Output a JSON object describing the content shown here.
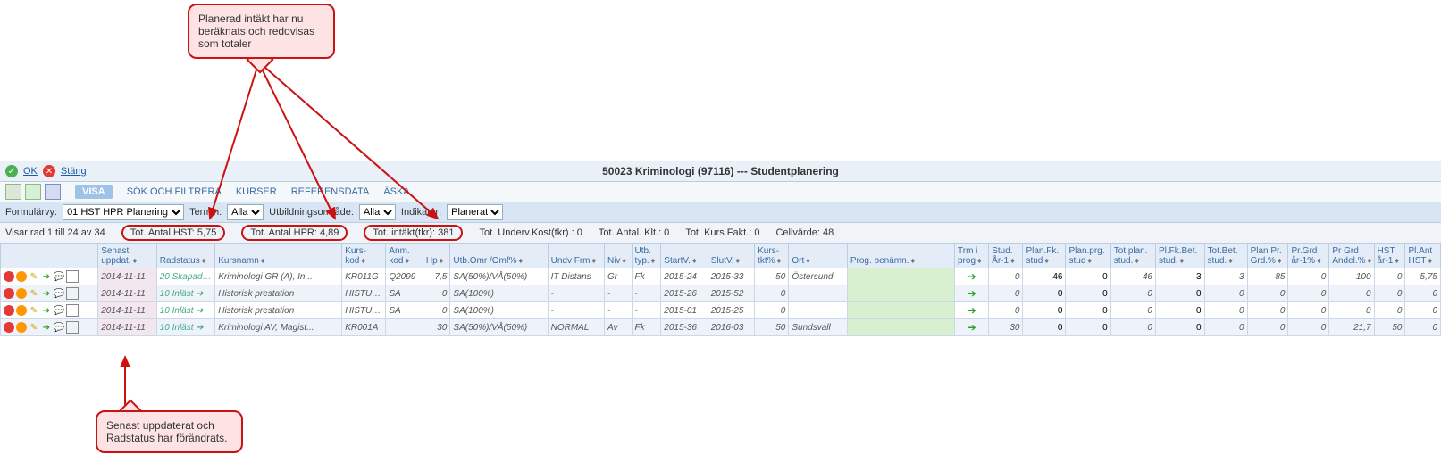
{
  "annotations": {
    "top": "Planerad intäkt har nu beräknats och redovisas som totaler",
    "bottom": "Senast uppdaterat och Radstatus har förändrats."
  },
  "topbar": {
    "ok": "OK",
    "close": "Stäng"
  },
  "page_title": "50023 Kriminologi (97116) --- Studentplanering",
  "toolbar": {
    "tabs": [
      "VISA",
      "SÖK OCH FILTRERA",
      "KURSER",
      "REFERENSDATA",
      "ÄSKA"
    ]
  },
  "filterbar": {
    "formularvy_lbl": "Formulärvy:",
    "formularvy_val": "01 HST HPR Planering",
    "termin_lbl": "Termin:",
    "termin_val": "Alla",
    "utbomr_lbl": "Utbildningsområde:",
    "utbomr_val": "Alla",
    "indikator_lbl": "Indikator:",
    "indikator_val": "Planerat"
  },
  "status": {
    "showing": "Visar rad 1 till 24 av 34",
    "tot_hst": "Tot. Antal HST: 5,75",
    "tot_hpr": "Tot. Antal HPR: 4,89",
    "tot_intakt": "Tot. intäkt(tkr): 381",
    "tot_underv": "Tot. Underv.Kost(tkr).: 0",
    "tot_klt": "Tot. Antal. Klt.: 0",
    "tot_kursfakt": "Tot. Kurs Fakt.: 0",
    "cellvarde": "Cellvärde: 48"
  },
  "headers": [
    "",
    "Senast uppdat.",
    "Radstatus",
    "Kursnamn",
    "Kurs-kod",
    "Anm. kod",
    "Hp",
    "Utb.Omr /Omf%",
    "Undv Frm",
    "Niv",
    "Utb. typ.",
    "StartV.",
    "SlutV.",
    "Kurs-tkt%",
    "Ort",
    "Prog. benämn.",
    "Trm i prog",
    "Stud. År-1",
    "Plan.Fk. stud",
    "Plan.prg. stud",
    "Tot.plan. stud.",
    "Pl.Fk.Bet. stud.",
    "Tot.Bet. stud.",
    "Plan Pr. Grd.%",
    "Pr.Grd år-1%",
    "Pr Grd Andel.%",
    "HST år-1",
    "Pl.Ant HST"
  ],
  "rows": [
    {
      "date": "2014-11-11",
      "status": "20 Skapad",
      "kursnamn": "Kriminologi GR (A), In...",
      "kurskod": "KR011G",
      "anmkod": "Q2099",
      "hp": "7,5",
      "utbomr": "SA(50%)/VÅ(50%)",
      "undvfrm": "IT Distans",
      "niv": "Gr",
      "utbtyp": "Fk",
      "startv": "2015-24",
      "slutv": "2015-33",
      "tkt": "50",
      "ort": "Östersund",
      "prog": "",
      "trm": "→",
      "studar1": "0",
      "planfk": "46",
      "planprg": "0",
      "totplan": "46",
      "plfkbet": "3",
      "totbet": "3",
      "planpr": "85",
      "prgrdar1": "0",
      "prgrdandel": "100",
      "hstar1": "0",
      "plant": "5,75",
      "alt": false
    },
    {
      "date": "2014-11-11",
      "status": "10 Inläst",
      "kursnamn": "Historisk prestation",
      "kurskod": "HISTUTF",
      "anmkod": "SA",
      "hp": "0",
      "utbomr": "SA(100%)",
      "undvfrm": "-",
      "niv": "-",
      "utbtyp": "-",
      "startv": "2015-26",
      "slutv": "2015-52",
      "tkt": "0",
      "ort": "",
      "prog": "",
      "trm": "→",
      "studar1": "0",
      "planfk": "0",
      "planprg": "0",
      "totplan": "0",
      "plfkbet": "0",
      "totbet": "0",
      "planpr": "0",
      "prgrdar1": "0",
      "prgrdandel": "0",
      "hstar1": "0",
      "plant": "0",
      "alt": true
    },
    {
      "date": "2014-11-11",
      "status": "10 Inläst",
      "kursnamn": "Historisk prestation",
      "kurskod": "HISTUTF",
      "anmkod": "SA",
      "hp": "0",
      "utbomr": "SA(100%)",
      "undvfrm": "-",
      "niv": "-",
      "utbtyp": "-",
      "startv": "2015-01",
      "slutv": "2015-25",
      "tkt": "0",
      "ort": "",
      "prog": "",
      "trm": "→",
      "studar1": "0",
      "planfk": "0",
      "planprg": "0",
      "totplan": "0",
      "plfkbet": "0",
      "totbet": "0",
      "planpr": "0",
      "prgrdar1": "0",
      "prgrdandel": "0",
      "hstar1": "0",
      "plant": "0",
      "alt": false
    },
    {
      "date": "2014-11-11",
      "status": "10 Inläst",
      "kursnamn": "Kriminologi AV, Magist...",
      "kurskod": "KR001A",
      "anmkod": "",
      "hp": "30",
      "utbomr": "SA(50%)/VÅ(50%)",
      "undvfrm": "NORMAL",
      "niv": "Av",
      "utbtyp": "Fk",
      "startv": "2015-36",
      "slutv": "2016-03",
      "tkt": "50",
      "ort": "Sundsvall",
      "prog": "",
      "trm": "→",
      "studar1": "30",
      "planfk": "0",
      "planprg": "0",
      "totplan": "0",
      "plfkbet": "0",
      "totbet": "0",
      "planpr": "0",
      "prgrdar1": "0",
      "prgrdandel": "21,7",
      "hstar1": "50",
      "plant": "0",
      "alt": true
    }
  ]
}
